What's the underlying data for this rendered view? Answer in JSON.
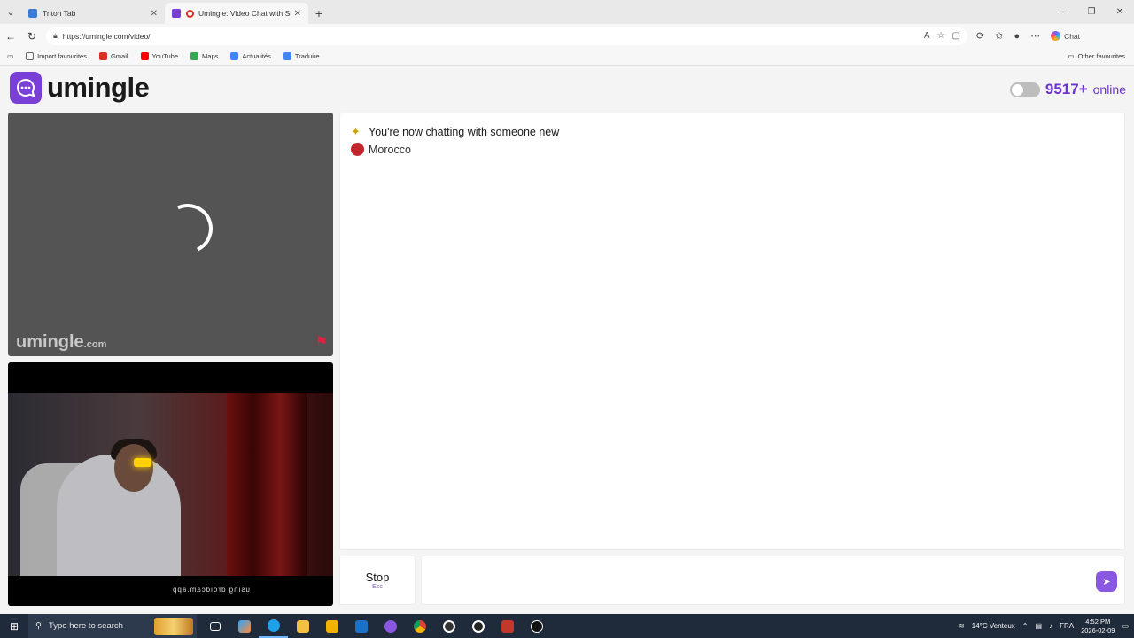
{
  "browser": {
    "tabs": [
      {
        "title": "Triton Tab",
        "favicon_color": "#3a7bd5",
        "active": false
      },
      {
        "title": "Umingle: Video Chat with Str",
        "favicon_color": "#7a3fd6",
        "active": true
      }
    ],
    "url": "https://umingle.com/video/",
    "copilot_label": "Chat",
    "favorites": [
      {
        "label": "Import favourites",
        "color": "#666666"
      },
      {
        "label": "Gmail",
        "color": "#d93025"
      },
      {
        "label": "YouTube",
        "color": "#ff0000"
      },
      {
        "label": "Maps",
        "color": "#34a853"
      },
      {
        "label": "Actualités",
        "color": "#4285f4"
      },
      {
        "label": "Traduire",
        "color": "#4285f4"
      }
    ],
    "other_favourites": "Other favourites"
  },
  "header": {
    "logo_text": "umingle",
    "online_count": "9517+",
    "online_label": "online"
  },
  "remote_video": {
    "watermark": "umingle",
    "watermark_suffix": ".com"
  },
  "local_video": {
    "overlay_text": "using droidcam.app"
  },
  "chat": {
    "system_message": "You're now chatting with someone new",
    "country": "Morocco"
  },
  "controls": {
    "stop_label": "Stop",
    "stop_key": "Esc"
  },
  "taskbar": {
    "search_placeholder": "Type here to search",
    "weather": "14°C Venteux",
    "language": "FRA",
    "time": "4:52 PM",
    "date": "2026-02-09"
  }
}
